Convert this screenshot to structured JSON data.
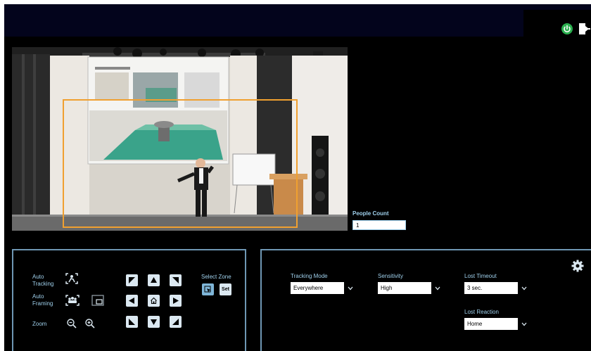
{
  "topbar": {
    "power_icon": "power-icon",
    "exit_icon": "exit-icon",
    "accent_color": "#2bb04f"
  },
  "camera": {
    "image": "live-camera-feed",
    "tracking_zone_color": "#f0a030"
  },
  "people_count": {
    "label": "People Count",
    "value": "1"
  },
  "controls": {
    "auto_tracking": {
      "label": "Auto\nTracking",
      "icon": "person-target-icon"
    },
    "auto_framing": {
      "label": "Auto\nFraming",
      "icon": "group-target-icon",
      "secondary_icon": "frame-adjust-icon"
    },
    "zoom": {
      "label": "Zoom",
      "zoom_out_icon": "zoom-out-icon",
      "zoom_in_icon": "zoom-in-icon"
    },
    "ptz": {
      "icons": [
        "arrow-up-left-icon",
        "arrow-up-icon",
        "arrow-up-right-icon",
        "arrow-left-icon",
        "home-icon",
        "arrow-right-icon",
        "arrow-down-left-icon",
        "arrow-down-icon",
        "arrow-down-right-icon"
      ]
    },
    "select_zone": {
      "label": "Select Zone",
      "select_icon": "cursor-select-icon",
      "set_label": "Set"
    }
  },
  "settings": {
    "tracking_mode": {
      "label": "Tracking Mode",
      "value": "Everywhere"
    },
    "sensitivity": {
      "label": "Sensitivity",
      "value": "High"
    },
    "lost_timeout": {
      "label": "Lost Timeout",
      "value": "3 sec."
    },
    "lost_reaction": {
      "label": "Lost Reaction",
      "value": "Home"
    },
    "gear_icon": "gear-icon"
  }
}
